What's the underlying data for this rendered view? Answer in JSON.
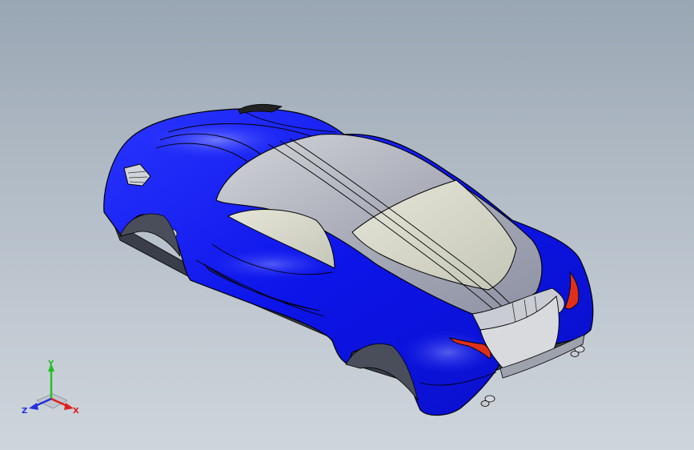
{
  "viewport": {
    "background_top": "#99a6b3",
    "background_bottom": "#cfd5dc"
  },
  "model": {
    "body_color": "#0a12e6",
    "glass_color": "#c8cac0",
    "roof_color": "#b9bcc4",
    "taillight_color": "#e0301a"
  },
  "triad": {
    "x_label": "X",
    "y_label": "Y",
    "z_label": "Z",
    "x_color": "#e0201a",
    "y_color": "#20c020",
    "z_color": "#2030e0"
  }
}
